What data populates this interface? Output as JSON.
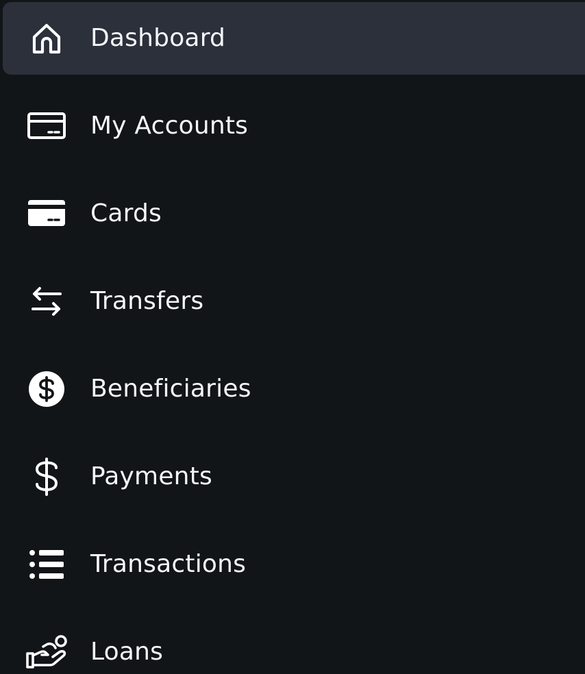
{
  "sidebar": {
    "items": [
      {
        "label": "Dashboard",
        "icon": "home-icon",
        "active": true
      },
      {
        "label": "My Accounts",
        "icon": "account-card-icon",
        "active": false
      },
      {
        "label": "Cards",
        "icon": "credit-card-icon",
        "active": false
      },
      {
        "label": "Transfers",
        "icon": "transfer-arrows-icon",
        "active": false
      },
      {
        "label": "Beneficiaries",
        "icon": "dollar-circle-icon",
        "active": false
      },
      {
        "label": "Payments",
        "icon": "dollar-icon",
        "active": false
      },
      {
        "label": "Transactions",
        "icon": "list-icon",
        "active": false
      },
      {
        "label": "Loans",
        "icon": "hand-coins-icon",
        "active": false
      }
    ]
  },
  "colors": {
    "background": "#121518",
    "active_background": "#2b303b",
    "text": "#f5f6f7",
    "icon": "#ffffff"
  }
}
